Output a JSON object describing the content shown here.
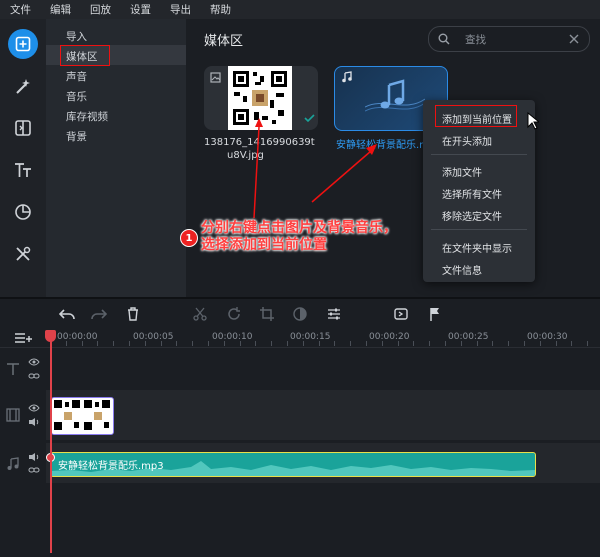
{
  "menubar": [
    "文件",
    "编辑",
    "回放",
    "设置",
    "导出",
    "帮助"
  ],
  "categories": [
    "导入",
    "媒体区",
    "声音",
    "音乐",
    "库存视频",
    "背景"
  ],
  "media": {
    "title": "媒体区",
    "search_placeholder": "查找",
    "items": [
      {
        "name_line1": "138176_1416990639t",
        "name_line2": "u8V.jpg"
      },
      {
        "name": "安静轻松背景配乐.mp3"
      }
    ]
  },
  "context_menu": {
    "items": [
      "添加到当前位置",
      "在开头添加",
      "添加文件",
      "选择所有文件",
      "移除选定文件",
      "在文件夹中显示",
      "文件信息"
    ]
  },
  "ruler": [
    "00:00:00",
    "00:00:05",
    "00:00:10",
    "00:00:15",
    "00:00:20",
    "00:00:25",
    "00:00:30"
  ],
  "audio_clip": {
    "label": "安静轻松背景配乐.mp3"
  },
  "annotation": {
    "number": "1",
    "line1": "分别右键点击图片及背景音乐，",
    "line2": "选择添加到当前位置"
  },
  "colors": {
    "accent": "#1e8fe9",
    "audio_clip": "#1aa39a",
    "playhead": "#e0424a",
    "annotation": "#ff2020"
  }
}
